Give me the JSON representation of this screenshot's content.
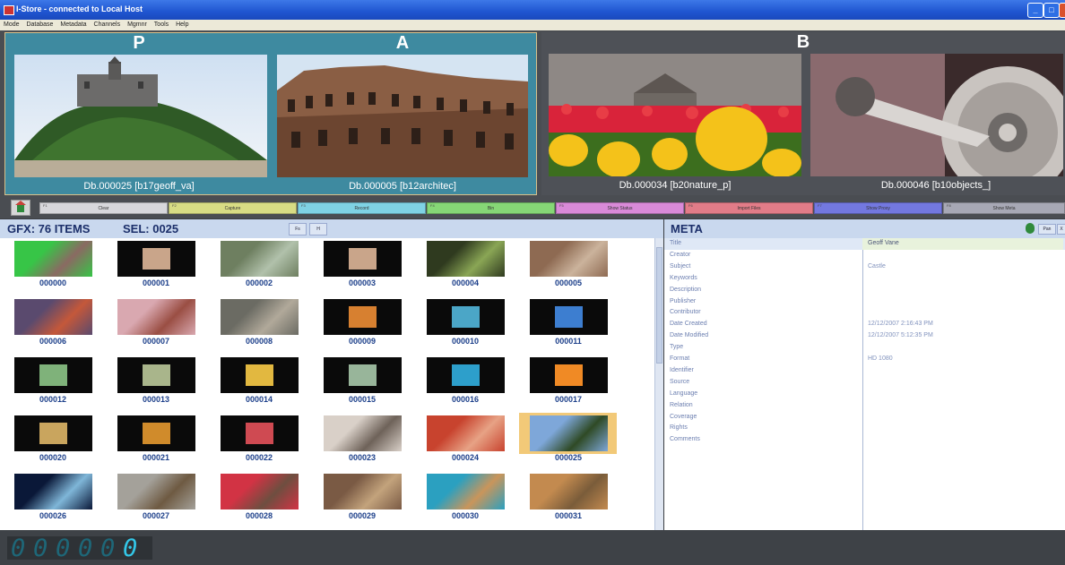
{
  "window": {
    "title": "I-Store - connected to Local Host",
    "controls": [
      "minimize",
      "maximize",
      "close"
    ]
  },
  "menu": [
    "Mode",
    "Database",
    "Metadata",
    "Channels",
    "Mgmnr",
    "Tools",
    "Help"
  ],
  "monitors": [
    {
      "letter": "P",
      "caption": "Db.000025 [b17geoff_va]",
      "scene": "castle-on-hill"
    },
    {
      "letter": "A",
      "caption": "Db.000005 [b12architec]",
      "scene": "old-buildings"
    },
    {
      "letter": "B",
      "caption": "Db.000034 [b20nature_p]",
      "scene": "tulips"
    },
    {
      "letter": "",
      "caption": "Db.000046 [b10objects_]",
      "scene": "hard-drive"
    }
  ],
  "function_buttons": [
    {
      "key": "F1",
      "label": "Clear",
      "color": "#d7d7db"
    },
    {
      "key": "F2",
      "label": "Capture",
      "color": "#d8dc84"
    },
    {
      "key": "F3",
      "label": "Record",
      "color": "#7fd2e4"
    },
    {
      "key": "F4",
      "label": "Bin",
      "color": "#86d776"
    },
    {
      "key": "F5",
      "label": "Show Status",
      "color": "#d98ad8"
    },
    {
      "key": "F6",
      "label": "Import Files",
      "color": "#e27c88"
    },
    {
      "key": "F7",
      "label": "Show Proxy",
      "color": "#7378e0"
    },
    {
      "key": "F8",
      "label": "Show Meta",
      "color": "#a7a8b5"
    }
  ],
  "gfx": {
    "title": "GFX: 76 ITEMS",
    "selection": "SEL: 0025",
    "buttons": [
      "Fs",
      "H"
    ],
    "items": [
      {
        "id": "000000",
        "colors": [
          "#37c547",
          "#8a6a62"
        ]
      },
      {
        "id": "000001",
        "colors": [
          "#0a0a0a",
          "#c9a58a"
        ]
      },
      {
        "id": "000002",
        "colors": [
          "#6e7f60",
          "#b1c1ab"
        ]
      },
      {
        "id": "000003",
        "colors": [
          "#0a0a0a",
          "#c9a58a"
        ]
      },
      {
        "id": "000004",
        "colors": [
          "#2f3a1f",
          "#8aa655"
        ]
      },
      {
        "id": "000005",
        "colors": [
          "#8e6a52",
          "#cbb39c"
        ]
      },
      {
        "id": "000006",
        "colors": [
          "#5a4a6e",
          "#c4583a"
        ]
      },
      {
        "id": "000007",
        "colors": [
          "#d9a8b0",
          "#9a4e43"
        ]
      },
      {
        "id": "000008",
        "colors": [
          "#6b6b63",
          "#b1a99a"
        ]
      },
      {
        "id": "000009",
        "colors": [
          "#0a0a0a",
          "#d78030"
        ]
      },
      {
        "id": "000010",
        "colors": [
          "#0a0a0a",
          "#4ba6c7"
        ]
      },
      {
        "id": "000011",
        "colors": [
          "#0a0a0a",
          "#3d7ed0"
        ]
      },
      {
        "id": "000012",
        "colors": [
          "#0a0a0a",
          "#7fb27a"
        ]
      },
      {
        "id": "000013",
        "colors": [
          "#0a0a0a",
          "#a9b58b"
        ]
      },
      {
        "id": "000014",
        "colors": [
          "#0a0a0a",
          "#e2b840"
        ]
      },
      {
        "id": "000015",
        "colors": [
          "#0a0a0a",
          "#98b59a"
        ]
      },
      {
        "id": "000016",
        "colors": [
          "#0a0a0a",
          "#2d9fcb"
        ]
      },
      {
        "id": "000017",
        "colors": [
          "#0a0a0a",
          "#f08a25"
        ]
      },
      {
        "id": "000020",
        "colors": [
          "#0a0a0a",
          "#c9a55e"
        ]
      },
      {
        "id": "000021",
        "colors": [
          "#0a0a0a",
          "#d08b2b"
        ]
      },
      {
        "id": "000022",
        "colors": [
          "#0a0a0a",
          "#cf4a52"
        ]
      },
      {
        "id": "000023",
        "colors": [
          "#d9d0c8",
          "#6e6259"
        ]
      },
      {
        "id": "000024",
        "colors": [
          "#c8432e",
          "#e7a285"
        ]
      },
      {
        "id": "000025",
        "colors": [
          "#7ea7d9",
          "#2f4a25"
        ]
      },
      {
        "id": "000026",
        "colors": [
          "#0a1838",
          "#7fb6d8"
        ]
      },
      {
        "id": "000027",
        "colors": [
          "#a4a19a",
          "#6e5a42"
        ]
      },
      {
        "id": "000028",
        "colors": [
          "#d23344",
          "#6e4e40"
        ]
      },
      {
        "id": "000029",
        "colors": [
          "#7a5a44",
          "#c3a37c"
        ]
      },
      {
        "id": "000030",
        "colors": [
          "#2ba0c0",
          "#c9955b"
        ]
      },
      {
        "id": "000031",
        "colors": [
          "#c38a4f",
          "#7a5c3a"
        ]
      }
    ]
  },
  "meta": {
    "title": "META",
    "buttons": [
      "Pan",
      "X"
    ],
    "rows": [
      {
        "key": "Title",
        "value": "Geoff Vane"
      },
      {
        "key": "Creator",
        "value": ""
      },
      {
        "key": "Subject",
        "value": "Castle"
      },
      {
        "key": "Keywords",
        "value": ""
      },
      {
        "key": "Description",
        "value": ""
      },
      {
        "key": "Publisher",
        "value": ""
      },
      {
        "key": "Contributor",
        "value": ""
      },
      {
        "key": "Date Created",
        "value": "12/12/2007 2:16:43 PM"
      },
      {
        "key": "Date Modified",
        "value": "12/12/2007 5:12:35 PM"
      },
      {
        "key": "Type",
        "value": ""
      },
      {
        "key": "Format",
        "value": "HD 1080"
      },
      {
        "key": "Identifier",
        "value": ""
      },
      {
        "key": "Source",
        "value": ""
      },
      {
        "key": "Language",
        "value": ""
      },
      {
        "key": "Relation",
        "value": ""
      },
      {
        "key": "Coverage",
        "value": ""
      },
      {
        "key": "Rights",
        "value": ""
      },
      {
        "key": "Comments",
        "value": ""
      }
    ]
  },
  "counter": {
    "digits": "000000",
    "lit_count": 1
  },
  "colors": {
    "accent_teal": "#3e8aa0",
    "selected_gold": "#f2c978",
    "panel_header": "#c9d8ee"
  }
}
